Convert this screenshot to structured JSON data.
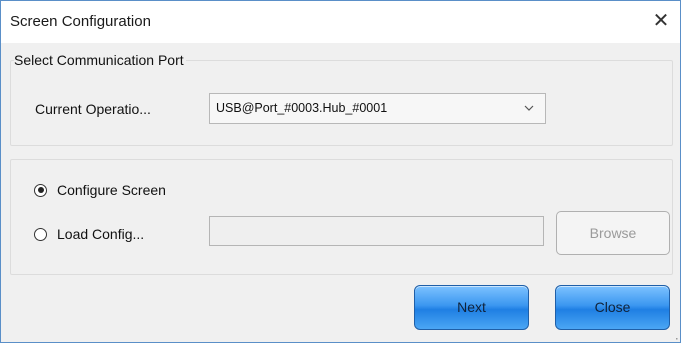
{
  "window": {
    "title": "Screen Configuration",
    "close_glyph": "✕"
  },
  "port_group": {
    "legend": "Select Communication Port",
    "operation_label": "Current Operatio...",
    "selected_port": "USB@Port_#0003.Hub_#0001"
  },
  "config_group": {
    "configure_label": "Configure Screen",
    "configure_checked": true,
    "load_label": "Load Config...",
    "load_checked": false,
    "path_value": "",
    "browse_label": "Browse"
  },
  "footer": {
    "next_label": "Next",
    "close_label": "Close"
  },
  "colors": {
    "accent_border": "#5a8fc8",
    "button_blue": "#3b97f0",
    "dialog_bg": "#f0f0f0"
  }
}
